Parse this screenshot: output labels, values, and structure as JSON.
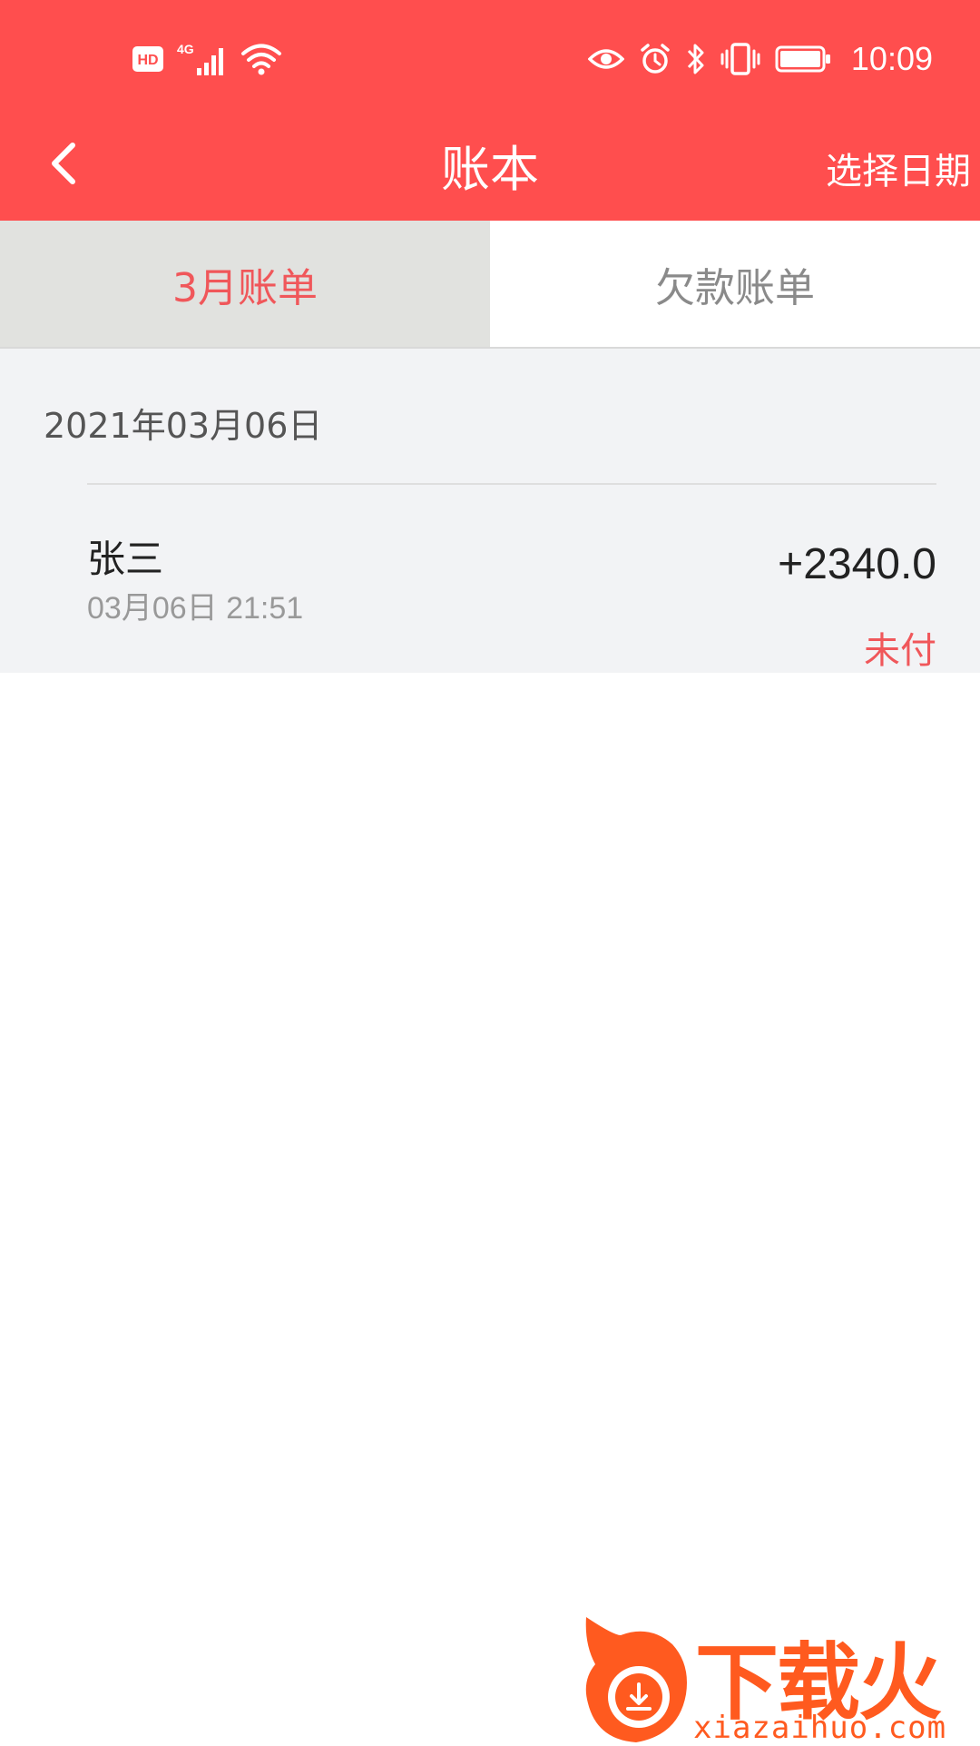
{
  "status_bar": {
    "network_hd": "HD",
    "network_type": "4G",
    "time": "10:09"
  },
  "app_bar": {
    "title": "账本",
    "action_label": "选择日期"
  },
  "tabs": [
    {
      "label": "3月账单",
      "active": true
    },
    {
      "label": "欠款账单",
      "active": false
    }
  ],
  "records": {
    "date": "2021年03月06日",
    "items": [
      {
        "name": "张三",
        "time": "03月06日 21:51",
        "amount": "+2340.0",
        "status": "未付"
      }
    ]
  },
  "watermark": {
    "brand": "下载火",
    "url": "xiazaihuo.com"
  },
  "colors": {
    "primary": "#FF4E4E",
    "accent_text": "#F0575A",
    "tab_active_bg": "#E1E2DF",
    "list_bg": "#F2F3F5",
    "watermark": "#FF5A1F"
  }
}
